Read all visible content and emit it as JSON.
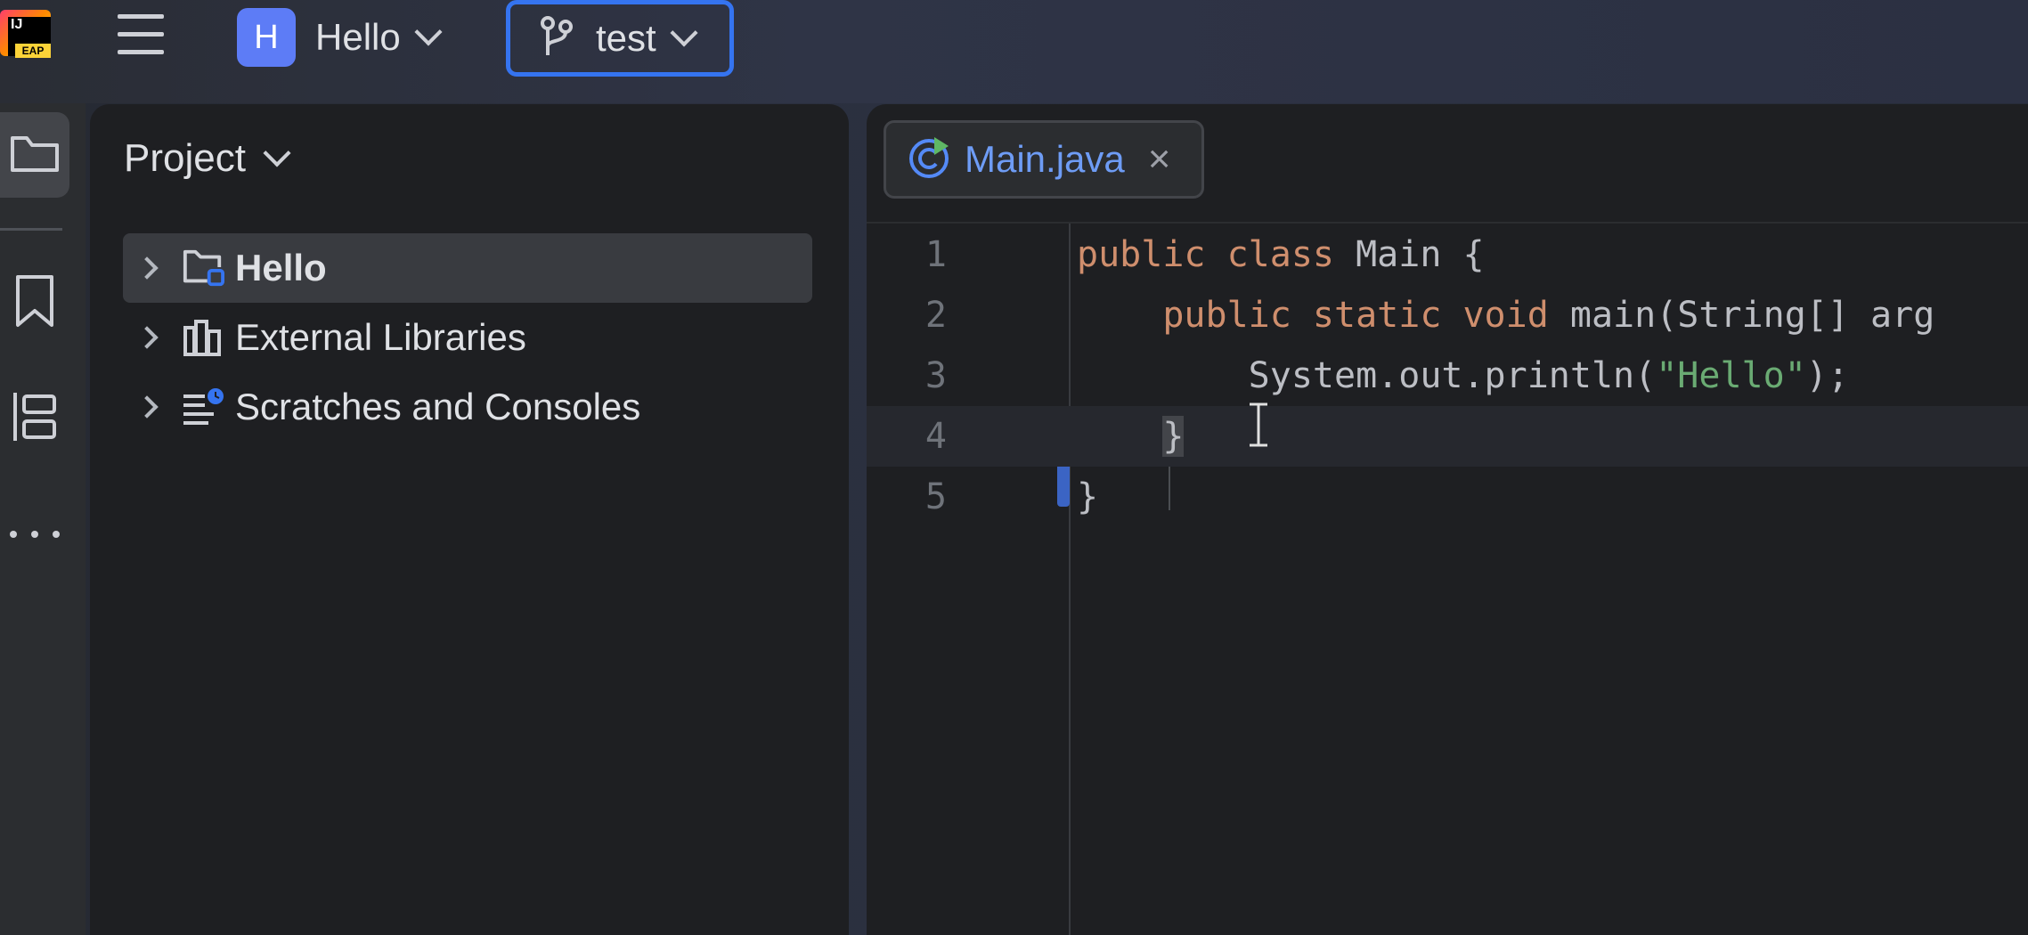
{
  "app": {
    "logo_text": "IJ",
    "logo_badge": "EAP"
  },
  "titlebar": {
    "project_initial": "H",
    "project_name": "Hello",
    "branch_name": "test"
  },
  "toolstrip": {
    "items": [
      "folder-icon",
      "bookmark-icon",
      "structure-icon",
      "more-icon"
    ]
  },
  "project_panel": {
    "title": "Project",
    "tree": [
      {
        "label": "Hello",
        "icon": "module-folder-icon",
        "selected": true
      },
      {
        "label": "External Libraries",
        "icon": "library-icon",
        "selected": false
      },
      {
        "label": "Scratches and Consoles",
        "icon": "scratches-icon",
        "selected": false
      }
    ]
  },
  "editor": {
    "tab": {
      "label": "Main.java",
      "icon": "java-class-icon"
    },
    "lines": [
      {
        "num": "1",
        "text": "public class Main {"
      },
      {
        "num": "2",
        "text": "    public static void main(String[] arg"
      },
      {
        "num": "3",
        "text": "        System.out.println(\"Hello\");"
      },
      {
        "num": "4",
        "text": "    }"
      },
      {
        "num": "5",
        "text": "}"
      }
    ],
    "current_line": "4"
  },
  "colors": {
    "accent": "#3574f0",
    "keyword": "#cf8e6d",
    "string": "#6aab73",
    "tab_label": "#6e9cf5",
    "project_badge": "#5d7cf6"
  }
}
